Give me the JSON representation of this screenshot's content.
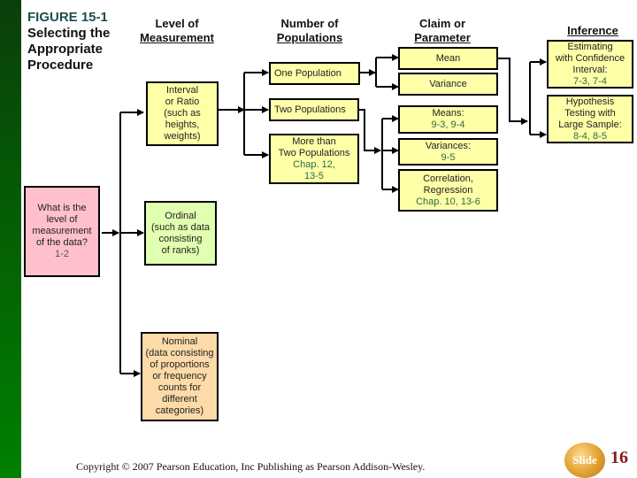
{
  "figure": {
    "number": "FIGURE 15-1",
    "title_lines": [
      "Selecting the",
      "Appropriate",
      "Procedure"
    ]
  },
  "column_headers": {
    "level": [
      "Level of",
      "Measurement"
    ],
    "populations": [
      "Number of",
      "Populations"
    ],
    "claim": [
      "Claim  or",
      "Parameter"
    ],
    "inference": "Inference"
  },
  "boxes": {
    "question": {
      "lines": [
        "What is the",
        "level of",
        "measurement",
        "of the data?"
      ],
      "ref": "1-2",
      "color": "#ffc0cb"
    },
    "interval": {
      "lines": [
        "Interval",
        "or Ratio",
        "(such as",
        "heights,",
        "weights)"
      ],
      "color": "#ffffa8"
    },
    "ordinal": {
      "lines": [
        "Ordinal",
        "(such as data",
        "consisting",
        "of  ranks)"
      ],
      "color": "#e0ffb0"
    },
    "nominal": {
      "lines": [
        "Nominal",
        "(data consisting",
        "of proportions",
        "or frequency",
        "counts for",
        "different",
        "categories)"
      ],
      "color": "#fcdba8"
    },
    "one_population": {
      "label": "One Population"
    },
    "two_populations": {
      "label": "Two Populations"
    },
    "more_than_two": {
      "lines": [
        "More than",
        "Two Populations"
      ],
      "ref_lines": [
        "Chap. 12,",
        "13-5"
      ]
    },
    "mean": {
      "label": "Mean"
    },
    "variance": {
      "label": "Variance"
    },
    "means": {
      "label": "Means:",
      "ref": "9-3, 9-4"
    },
    "variances": {
      "label": "Variances:",
      "ref": "9-5"
    },
    "correlation": {
      "lines": [
        "Correlation,",
        "Regression"
      ],
      "ref": "Chap. 10,  13-6"
    },
    "estimating": {
      "lines": [
        "Estimating",
        "with Confidence",
        "Interval:"
      ],
      "ref": "7-3, 7-4"
    },
    "hypothesis": {
      "lines": [
        "Hypothesis",
        "Testing with",
        "Large Sample:"
      ],
      "ref": "8-4, 8-5"
    }
  },
  "footer": {
    "copyright": "Copyright © 2007 Pearson Education, Inc Publishing as Pearson Addison-Wesley.",
    "slide_label": "Slide",
    "slide_number": "16"
  },
  "colors": {
    "sidebar_top": "#0a3f0a",
    "sidebar_bottom": "#008000",
    "box_default": "#ffffa8",
    "reference_text": "#2e6b4a",
    "slide_number": "#8b1a1a"
  }
}
